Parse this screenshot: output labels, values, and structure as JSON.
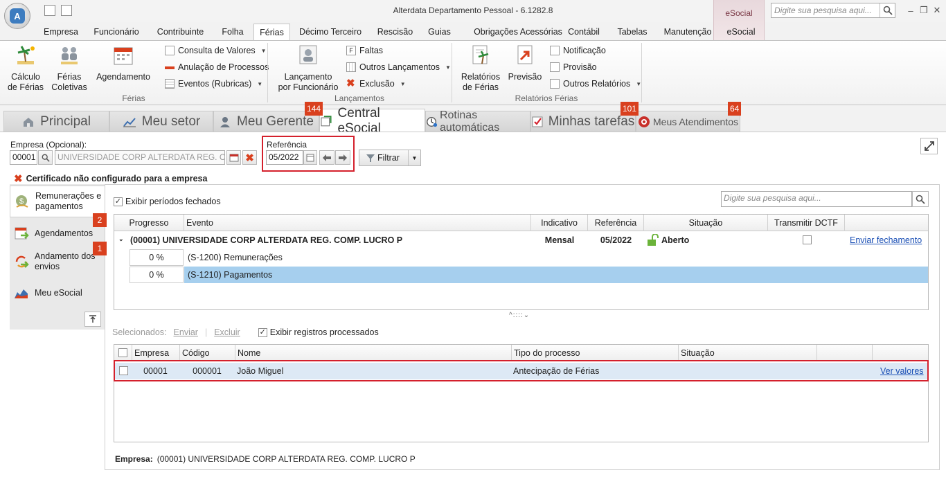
{
  "window": {
    "title": "Alterdata Departamento Pessoal - 6.1282.8",
    "context_tab": "eSocial",
    "search_placeholder": "Digite sua pesquisa aqui..."
  },
  "menu": {
    "tabs": [
      "Empresa",
      "Funcionário",
      "Contribuinte",
      "Folha",
      "Férias",
      "Décimo Terceiro",
      "Rescisão",
      "Guias",
      "Obrigações Acessórias",
      "Contábil",
      "Tabelas",
      "Manutenção",
      "eSocial"
    ],
    "active": "Férias"
  },
  "ribbon": {
    "ferias": {
      "label": "Férias",
      "calculo": [
        "Cálculo",
        "de Férias"
      ],
      "coletivas": [
        "Férias",
        "Coletivas"
      ],
      "agendamento": "Agendamento",
      "consulta": "Consulta de Valores",
      "anulacao": "Anulação de Processos",
      "eventos": "Eventos (Rubricas)"
    },
    "lancamentos": {
      "label": "Lançamentos",
      "por_funcionario": [
        "Lançamento",
        "por Funcionário"
      ],
      "faltas": "Faltas",
      "outros": "Outros Lançamentos",
      "exclusao": "Exclusão"
    },
    "relatorios": {
      "label": "Relatórios Férias",
      "relatorios": [
        "Relatórios",
        "de Férias"
      ],
      "previsao": "Previsão",
      "notificacao": "Notificação",
      "provisao": "Provisão",
      "outros": "Outros Relatórios"
    }
  },
  "tabs": [
    {
      "label": "Principal",
      "icon": "home-icon"
    },
    {
      "label": "Meu setor",
      "icon": "chart-icon"
    },
    {
      "label": "Meu Gerente",
      "icon": "person-icon",
      "badge": "144"
    },
    {
      "label": "Central eSocial",
      "icon": "esocial-icon"
    },
    {
      "label": "Rotinas automáticas",
      "icon": "clock-icon"
    },
    {
      "label": "Minhas tarefas",
      "icon": "checkbox-icon",
      "badge": "101"
    },
    {
      "label": "Meus Atendimentos",
      "icon": "support-icon",
      "badge": "64"
    }
  ],
  "filters": {
    "empresa_label": "Empresa (Opcional):",
    "empresa_code": "00001",
    "empresa_name": "UNIVERSIDADE CORP ALTERDATA REG. COMP",
    "referencia_label": "Referência",
    "referencia_value": "05/2022",
    "filtrar": "Filtrar"
  },
  "warning": "Certificado não configurado para a empresa",
  "sidebar": {
    "items": [
      {
        "label": "Remunerações e pagamentos",
        "icon": "money-icon"
      },
      {
        "label": "Agendamentos",
        "icon": "calendar-icon",
        "badge": "2"
      },
      {
        "label": "Andamento dos envios",
        "icon": "sync-icon",
        "badge": "1"
      },
      {
        "label": "Meu eSocial",
        "icon": "chart-icon"
      }
    ]
  },
  "events": {
    "exibir_fechados": "Exibir períodos fechados",
    "search_placeholder": "Digite sua pesquisa aqui...",
    "columns": [
      "Progresso",
      "Evento",
      "Indicativo",
      "Referência",
      "Situação",
      "Transmitir DCTF"
    ],
    "group": {
      "title": "(00001) UNIVERSIDADE CORP ALTERDATA REG. COMP. LUCRO P",
      "indicativo": "Mensal",
      "referencia": "05/2022",
      "situacao": "Aberto",
      "action": "Enviar fechamento"
    },
    "rows": [
      {
        "progresso": "0 %",
        "evento": "(S-1200) Remunerações"
      },
      {
        "progresso": "0 %",
        "evento": "(S-1210) Pagamentos"
      }
    ]
  },
  "records": {
    "toolbar": {
      "selecionados": "Selecionados:",
      "enviar": "Enviar",
      "excluir": "Excluir",
      "exibir_processados": "Exibir registros processados"
    },
    "columns": [
      "Empresa",
      "Código",
      "Nome",
      "Tipo do processo",
      "Situação"
    ],
    "rows": [
      {
        "empresa": "00001",
        "codigo": "000001",
        "nome": "João Miguel",
        "tipo": "Antecipação de Férias",
        "situacao": "",
        "action": "Ver valores"
      }
    ]
  },
  "footer": {
    "label": "Empresa:",
    "value": "(00001) UNIVERSIDADE CORP ALTERDATA REG. COMP. LUCRO P"
  },
  "colors": {
    "accent_red": "#d4202c",
    "badge": "#d9401e",
    "selection": "#a6cfee",
    "link": "#1a4fb5"
  }
}
